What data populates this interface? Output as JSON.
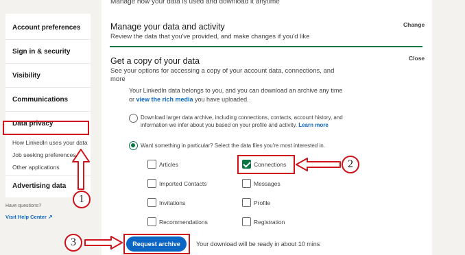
{
  "sidebar": {
    "sections": [
      {
        "label": "Account preferences"
      },
      {
        "label": "Sign in & security"
      },
      {
        "label": "Visibility"
      },
      {
        "label": "Communications"
      },
      {
        "label": "Data privacy"
      },
      {
        "label": "Advertising data"
      }
    ],
    "subitems": [
      {
        "label": "How LinkedIn uses your data"
      },
      {
        "label": "Job seeking preferences"
      },
      {
        "label": "Other applications"
      }
    ],
    "help_question": "Have questions?",
    "help_link": "Visit Help Center"
  },
  "main": {
    "top_text": "Manage how your data is used and download it anytime",
    "manage": {
      "title": "Manage your data and activity",
      "desc": "Review the data that you've provided, and make changes if you'd like",
      "action": "Change"
    },
    "copy": {
      "title": "Get a copy of your data",
      "desc": "See your options for accessing a copy of your account data, connections, and more",
      "action": "Close",
      "body_prefix": "Your LinkedIn data belongs to you, and you can download an archive any time or ",
      "body_link": "view the rich media",
      "body_suffix": " you have uploaded.",
      "option1_text": "Download larger data archive, including connections, contacts, account history, and information we infer about you based on your profile and activity. ",
      "option1_link": "Learn more",
      "option2_text": "Want something in particular? Select the data files you're most interested in.",
      "checkboxes": [
        {
          "label": "Articles",
          "checked": false
        },
        {
          "label": "Connections",
          "checked": true
        },
        {
          "label": "Imported Contacts",
          "checked": false
        },
        {
          "label": "Messages",
          "checked": false
        },
        {
          "label": "Invitations",
          "checked": false
        },
        {
          "label": "Profile",
          "checked": false
        },
        {
          "label": "Recommendations",
          "checked": false
        },
        {
          "label": "Registration",
          "checked": false
        }
      ],
      "request_button": "Request archive",
      "download_note": "Your download will be ready in about 10 mins"
    }
  },
  "annotations": {
    "step1": "1",
    "step2": "2",
    "step3": "3",
    "color": "#d0121b"
  },
  "colors": {
    "accent": "#0a66c2",
    "success": "#057642",
    "annotation": "#d0121b"
  }
}
